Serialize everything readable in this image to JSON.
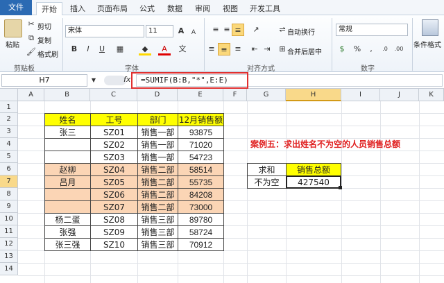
{
  "tabs": [
    "文件",
    "开始",
    "插入",
    "页面布局",
    "公式",
    "数据",
    "审阅",
    "视图",
    "开发工具"
  ],
  "ribbon": {
    "clipboard": {
      "paste": "粘贴",
      "cut": "剪切",
      "copy": "复制",
      "format_painter": "格式刷",
      "label": "剪贴板"
    },
    "font": {
      "name": "宋体",
      "size": "11",
      "label": "字体",
      "bold": "B",
      "italic": "I",
      "underline": "U"
    },
    "alignment": {
      "wrap": "自动换行",
      "merge": "合并后居中",
      "label": "对齐方式"
    },
    "number": {
      "format": "常规",
      "label": "数字"
    },
    "styles": {
      "conditional": "条件格式"
    }
  },
  "formula_bar": {
    "name_box": "H7",
    "fx": "fx",
    "formula": "=SUMIF(B:B,\"*\",E:E)"
  },
  "columns": [
    "A",
    "B",
    "C",
    "D",
    "E",
    "F",
    "G",
    "H",
    "I",
    "J",
    "K"
  ],
  "rows": [
    "1",
    "2",
    "3",
    "4",
    "5",
    "6",
    "7",
    "8",
    "9",
    "10",
    "11",
    "12",
    "13",
    "14"
  ],
  "table": {
    "headers": [
      "姓名",
      "工号",
      "部门",
      "12月销售额"
    ],
    "rows": [
      [
        "张三",
        "SZ01",
        "销售一部",
        "93875"
      ],
      [
        "",
        "SZ02",
        "销售一部",
        "71020"
      ],
      [
        "",
        "SZ03",
        "销售一部",
        "54723"
      ],
      [
        "赵柳",
        "SZ04",
        "销售二部",
        "58514"
      ],
      [
        "吕月",
        "SZ05",
        "销售二部",
        "55735"
      ],
      [
        "",
        "SZ06",
        "销售二部",
        "84208"
      ],
      [
        "",
        "SZ07",
        "销售二部",
        "73000"
      ],
      [
        "杨二蛋",
        "SZ08",
        "销售三部",
        "89780"
      ],
      [
        "张强",
        "SZ09",
        "销售三部",
        "58724"
      ],
      [
        "张三强",
        "SZ10",
        "销售三部",
        "70912"
      ]
    ]
  },
  "case_title": "案例五：求出姓名不为空的人员销售总额",
  "result": {
    "h1": "求和",
    "h2": "销售总额",
    "label": "不为空",
    "value": "427540"
  },
  "colors": {
    "header_yellow": "#ffff00",
    "peach": "#fbd5b5",
    "title_red": "#e02020",
    "file_tab": "#2b6ab3"
  }
}
